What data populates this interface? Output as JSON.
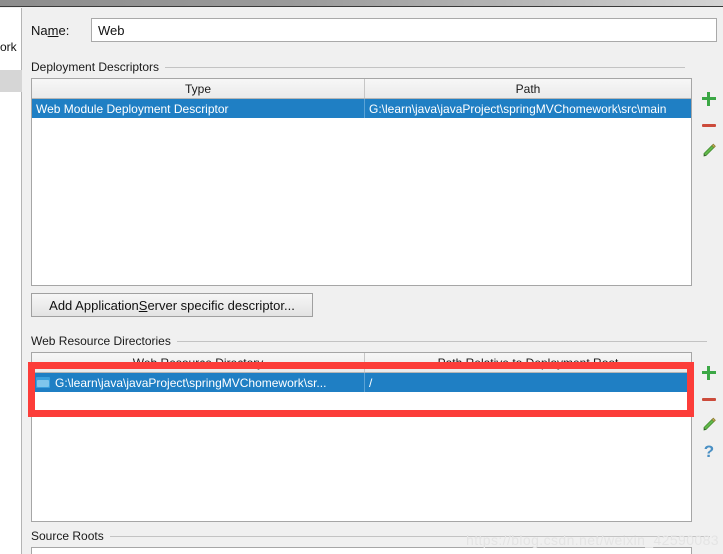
{
  "window": {
    "sidebar_visible_text": "ork"
  },
  "name_field": {
    "label_prefix": "Na",
    "label_mnemonic": "m",
    "label_suffix": "e:",
    "value": "Web",
    "placeholder": ""
  },
  "deployment_descriptors": {
    "group_label": "Deployment Descriptors",
    "columns": [
      "Type",
      "Path"
    ],
    "rows": [
      {
        "type": "Web Module Deployment Descriptor",
        "path": "G:\\learn\\java\\javaProject\\springMVChomework\\src\\main",
        "selected": true
      }
    ],
    "toolbar": [
      {
        "name": "add-icon",
        "glyph": "plus",
        "tooltip": "Add"
      },
      {
        "name": "remove-icon",
        "glyph": "minus",
        "tooltip": "Remove"
      },
      {
        "name": "edit-pencil-icon",
        "glyph": "pencil",
        "tooltip": "Edit"
      }
    ]
  },
  "add_descriptor_button": {
    "prefix": "Add Application ",
    "mnemonic": "S",
    "suffix": "erver specific descriptor..."
  },
  "web_resource_directories": {
    "group_label": "Web Resource Directories",
    "columns": [
      "Web Resource Directory",
      "Path Relative to Deployment Root"
    ],
    "rows": [
      {
        "directory": "G:\\learn\\java\\javaProject\\springMVChomework\\sr...",
        "relative_path": "/",
        "selected": true,
        "icon": "folder-icon"
      }
    ],
    "toolbar": [
      {
        "name": "add-icon",
        "glyph": "plus",
        "tooltip": "Add"
      },
      {
        "name": "remove-icon",
        "glyph": "minus",
        "tooltip": "Remove"
      },
      {
        "name": "edit-pencil-icon",
        "glyph": "pencil",
        "tooltip": "Edit"
      },
      {
        "name": "help-icon",
        "glyph": "question",
        "tooltip": "Help"
      }
    ]
  },
  "source_roots": {
    "group_label": "Source Roots"
  },
  "annotation": {
    "color": "#fc3d39",
    "shape": "rectangle"
  },
  "watermark": {
    "text": "https://blog.csdn.net/weixin_42590083"
  }
}
